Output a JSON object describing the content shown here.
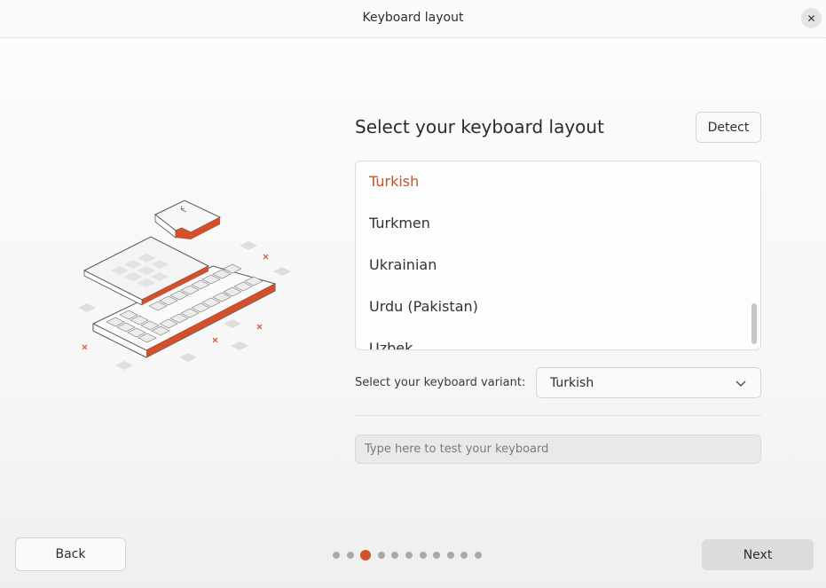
{
  "window": {
    "title": "Keyboard layout",
    "close_icon": "close-icon"
  },
  "main": {
    "heading": "Select your keyboard layout",
    "detect_label": "Detect",
    "layouts": [
      {
        "label": "Turkish",
        "selected": true
      },
      {
        "label": "Turkmen",
        "selected": false
      },
      {
        "label": "Ukrainian",
        "selected": false
      },
      {
        "label": "Urdu (Pakistan)",
        "selected": false
      },
      {
        "label": "Uzbek",
        "selected": false
      }
    ],
    "variant_label": "Select your keyboard variant:",
    "variant_value": "Turkish",
    "test_placeholder": "Type here to test your keyboard"
  },
  "footer": {
    "back_label": "Back",
    "next_label": "Next",
    "pager": {
      "total": 11,
      "current": 3
    }
  },
  "colors": {
    "accent": "#d4502a",
    "selected_text": "#c7532b"
  }
}
